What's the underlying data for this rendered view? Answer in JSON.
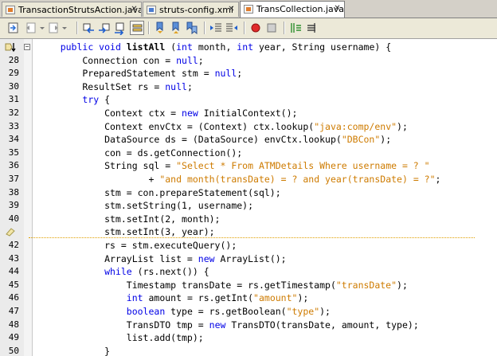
{
  "tabs": [
    {
      "label": "TransactionStrutsAction.java",
      "file_type": "java"
    },
    {
      "label": "struts-config.xml",
      "file_type": "xml"
    },
    {
      "label": "TransCollection.java",
      "file_type": "java",
      "active": true
    }
  ],
  "close_glyph": "✕",
  "toolbar": {
    "buttons": [
      "last-edit-icon",
      "back-icon",
      "forward-icon",
      "find-previous-icon",
      "find-next-icon",
      "find-selection-icon",
      "toggle-highlight-icon",
      "previous-bookmark-icon",
      "next-bookmark-icon",
      "toggle-bookmark-icon",
      "shift-left-icon",
      "shift-right-icon",
      "start-macro-icon",
      "stop-macro-icon",
      "comment-icon",
      "uncomment-icon"
    ]
  },
  "editor": {
    "fold_glyph": "−",
    "lines": [
      {
        "num": "",
        "marker": "bookmark",
        "tokens": [
          [
            "    ",
            ""
          ],
          [
            "public void ",
            "kw"
          ],
          [
            "listAll",
            "fn"
          ],
          [
            " (",
            ""
          ],
          [
            "int",
            "kw"
          ],
          [
            " month, ",
            ""
          ],
          [
            "int",
            "kw"
          ],
          [
            " year, String username) {",
            ""
          ]
        ]
      },
      {
        "num": "28",
        "tokens": [
          [
            "        Connection con = ",
            ""
          ],
          [
            "null",
            "kw"
          ],
          [
            ";",
            ""
          ]
        ]
      },
      {
        "num": "29",
        "tokens": [
          [
            "        PreparedStatement stm = ",
            ""
          ],
          [
            "null",
            "kw"
          ],
          [
            ";",
            ""
          ]
        ]
      },
      {
        "num": "30",
        "tokens": [
          [
            "        ResultSet rs = ",
            ""
          ],
          [
            "null",
            "kw"
          ],
          [
            ";",
            ""
          ]
        ]
      },
      {
        "num": "31",
        "tokens": [
          [
            "        ",
            ""
          ],
          [
            "try",
            "kw"
          ],
          [
            " {",
            ""
          ]
        ]
      },
      {
        "num": "32",
        "tokens": [
          [
            "            Context ctx = ",
            ""
          ],
          [
            "new",
            "kw"
          ],
          [
            " InitialContext();",
            ""
          ]
        ]
      },
      {
        "num": "33",
        "tokens": [
          [
            "            Context envCtx = (Context) ctx.lookup(",
            ""
          ],
          [
            "\"java:comp/env\"",
            "str"
          ],
          [
            ");",
            ""
          ]
        ]
      },
      {
        "num": "34",
        "tokens": [
          [
            "            DataSource ds = (DataSource) envCtx.lookup(",
            ""
          ],
          [
            "\"DBCon\"",
            "str"
          ],
          [
            ");",
            ""
          ]
        ]
      },
      {
        "num": "35",
        "tokens": [
          [
            "            con = ds.getConnection();",
            ""
          ]
        ]
      },
      {
        "num": "36",
        "tokens": [
          [
            "            String sql = ",
            ""
          ],
          [
            "\"Select * From ATMDetails Where username = ? \"",
            "str"
          ]
        ]
      },
      {
        "num": "37",
        "tokens": [
          [
            "                    + ",
            ""
          ],
          [
            "\"and month(transDate) = ? and year(transDate) = ?\"",
            "str"
          ],
          [
            ";",
            ""
          ]
        ]
      },
      {
        "num": "38",
        "tokens": [
          [
            "            stm = con.prepareStatement(sql);",
            ""
          ]
        ]
      },
      {
        "num": "39",
        "tokens": [
          [
            "            stm.setString(1, username);",
            ""
          ]
        ]
      },
      {
        "num": "40",
        "tokens": [
          [
            "            stm.setInt(2, month);",
            ""
          ]
        ]
      },
      {
        "num": "",
        "marker": "hint",
        "tokens": [
          [
            "            stm.setInt(3, year);",
            ""
          ]
        ]
      },
      {
        "num": "42",
        "tokens": [
          [
            "            rs = stm.executeQuery();",
            ""
          ]
        ]
      },
      {
        "num": "43",
        "tokens": [
          [
            "            ArrayList list = ",
            ""
          ],
          [
            "new",
            "kw"
          ],
          [
            " ArrayList();",
            ""
          ]
        ]
      },
      {
        "num": "44",
        "tokens": [
          [
            "            ",
            ""
          ],
          [
            "while",
            "kw"
          ],
          [
            " (rs.next()) {",
            ""
          ]
        ]
      },
      {
        "num": "45",
        "tokens": [
          [
            "                Timestamp transDate = rs.getTimestamp(",
            ""
          ],
          [
            "\"transDate\"",
            "str"
          ],
          [
            ");",
            ""
          ]
        ]
      },
      {
        "num": "46",
        "tokens": [
          [
            "                ",
            ""
          ],
          [
            "int",
            "kw"
          ],
          [
            " amount = rs.getInt(",
            ""
          ],
          [
            "\"amount\"",
            "str"
          ],
          [
            ");",
            ""
          ]
        ]
      },
      {
        "num": "47",
        "tokens": [
          [
            "                ",
            ""
          ],
          [
            "boolean",
            "kw"
          ],
          [
            " type = rs.getBoolean(",
            ""
          ],
          [
            "\"type\"",
            "str"
          ],
          [
            ");",
            ""
          ]
        ]
      },
      {
        "num": "48",
        "tokens": [
          [
            "                TransDTO tmp = ",
            ""
          ],
          [
            "new",
            "kw"
          ],
          [
            " TransDTO(transDate, amount, type);",
            ""
          ]
        ]
      },
      {
        "num": "49",
        "tokens": [
          [
            "                list.add(tmp);",
            ""
          ]
        ]
      },
      {
        "num": "50",
        "tokens": [
          [
            "            }",
            ""
          ]
        ]
      }
    ]
  }
}
